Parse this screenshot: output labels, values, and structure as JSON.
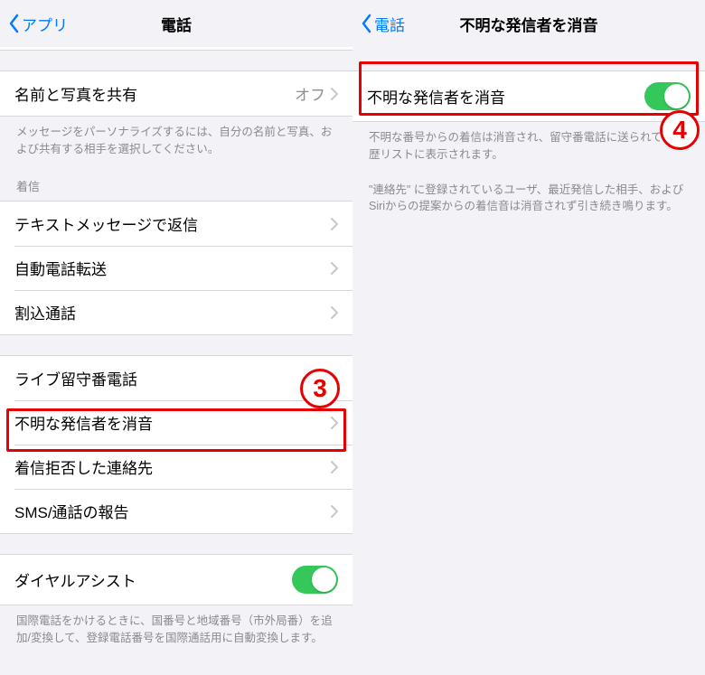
{
  "colors": {
    "accent": "#007aff",
    "toggle_on": "#34c759",
    "callout": "#e60000",
    "bg": "#f2f2f7"
  },
  "left": {
    "back_label": "アプリ",
    "title": "電話",
    "share": {
      "label": "名前と写真を共有",
      "value": "オフ",
      "footer": "メッセージをパーソナライズするには、自分の名前と写真、および共有する相手を選択してください。"
    },
    "incoming_header": "着信",
    "items_call": [
      {
        "label": "テキストメッセージで返信"
      },
      {
        "label": "自動電話転送"
      },
      {
        "label": "割込通話"
      }
    ],
    "items_silence": [
      {
        "label": "ライブ留守番電話"
      },
      {
        "label": "不明な発信者を消音"
      },
      {
        "label": "着信拒否した連絡先"
      },
      {
        "label": "SMS/通話の報告"
      }
    ],
    "dial_assist": {
      "label": "ダイヤルアシスト",
      "on": true,
      "footer": "国際電話をかけるときに、国番号と地域番号（市外局番）を追加/変換して、登録電話番号を国際通話用に自動変換します。"
    }
  },
  "right": {
    "back_label": "電話",
    "title": "不明な発信者を消音",
    "toggle_label": "不明な発信者を消音",
    "toggle_on": true,
    "footer1": "不明な番号からの着信は消音され、留守番電話に送られて、履歴リストに表示されます。",
    "footer2": "\"連絡先\" に登録されているユーザ、最近発信した相手、およびSiriからの提案からの着信音は消音されず引き続き鳴ります。"
  },
  "callouts": {
    "three": "3",
    "four": "4"
  }
}
